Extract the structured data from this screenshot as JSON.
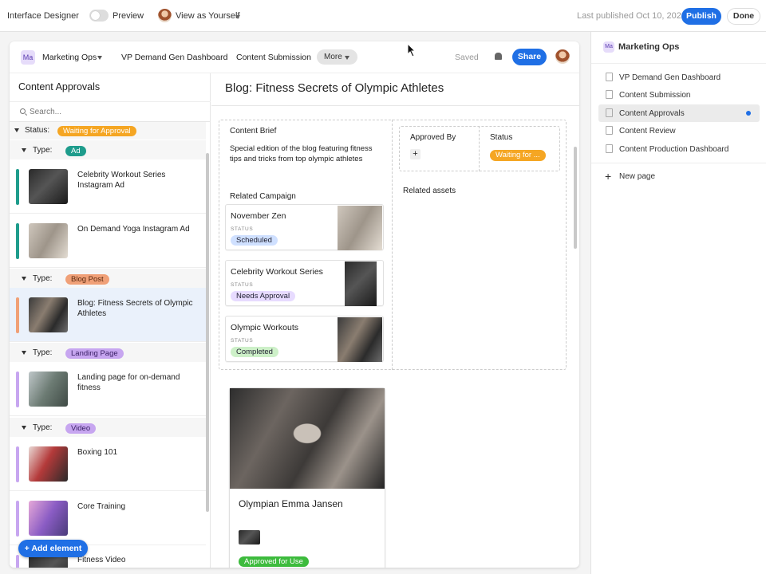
{
  "topbar": {
    "title": "Interface Designer",
    "preview_label": "Preview",
    "view_as": "View as Yourself",
    "last_published": "Last published Oct 10, 2022",
    "publish": "Publish",
    "done": "Done"
  },
  "app": {
    "workspace_badge": "Ma",
    "workspace": "Marketing Ops",
    "tabs": [
      "VP Demand Gen Dashboard",
      "Content Submission"
    ],
    "more": "More",
    "saved": "Saved",
    "share": "Share"
  },
  "list": {
    "title": "Content Approvals",
    "search_placeholder": "Search...",
    "status_label": "Status:",
    "status_value": "Waiting for Approval",
    "type_label": "Type:",
    "groups": [
      {
        "type": "Ad",
        "records": [
          "Celebrity Workout Series Instagram Ad",
          "On Demand Yoga Instagram Ad"
        ]
      },
      {
        "type": "Blog Post",
        "records": [
          "Blog: Fitness Secrets of Olympic Athletes"
        ]
      },
      {
        "type": "Landing Page",
        "records": [
          "Landing page for on-demand fitness"
        ]
      },
      {
        "type": "Video",
        "records": [
          "Boxing 101",
          "Core Training",
          "Fitness Video"
        ]
      }
    ],
    "add_element": "Add element"
  },
  "detail": {
    "title": "Blog: Fitness Secrets of Olympic Athletes",
    "brief_label": "Content Brief",
    "brief_text": "Special edition of the blog featuring fitness tips and tricks from top olympic athletes",
    "approved_by_label": "Approved By",
    "add_symbol": "+",
    "status_label": "Status",
    "status_value": "Waiting for ...",
    "related_campaign_label": "Related Campaign",
    "related_assets_label": "Related assets",
    "status_small": "STATUS",
    "campaigns": [
      {
        "name": "November Zen",
        "status": "Scheduled"
      },
      {
        "name": "Celebrity Workout Series",
        "status": "Needs Approval"
      },
      {
        "name": "Olympic Workouts",
        "status": "Completed"
      }
    ],
    "asset": {
      "name": "Olympian Emma Jansen",
      "status": "Approved for Use"
    }
  },
  "pages": {
    "workspace_badge": "Ma",
    "workspace": "Marketing Ops",
    "items": [
      "VP Demand Gen Dashboard",
      "Content Submission",
      "Content Approvals",
      "Content Review",
      "Content Production Dashboard"
    ],
    "new_page": "New page"
  },
  "colors": {
    "accent": "#1f6fe5",
    "waiting": "#f5a623",
    "ad": "#1e9c8c",
    "blog": "#f0a077",
    "landing": "#c7a6f0",
    "video": "#c7a6f0",
    "scheduled": "#cfe0ff",
    "needs_approval": "#e7dbff",
    "completed": "#cdf0c8",
    "approved": "#3dbb3d"
  }
}
